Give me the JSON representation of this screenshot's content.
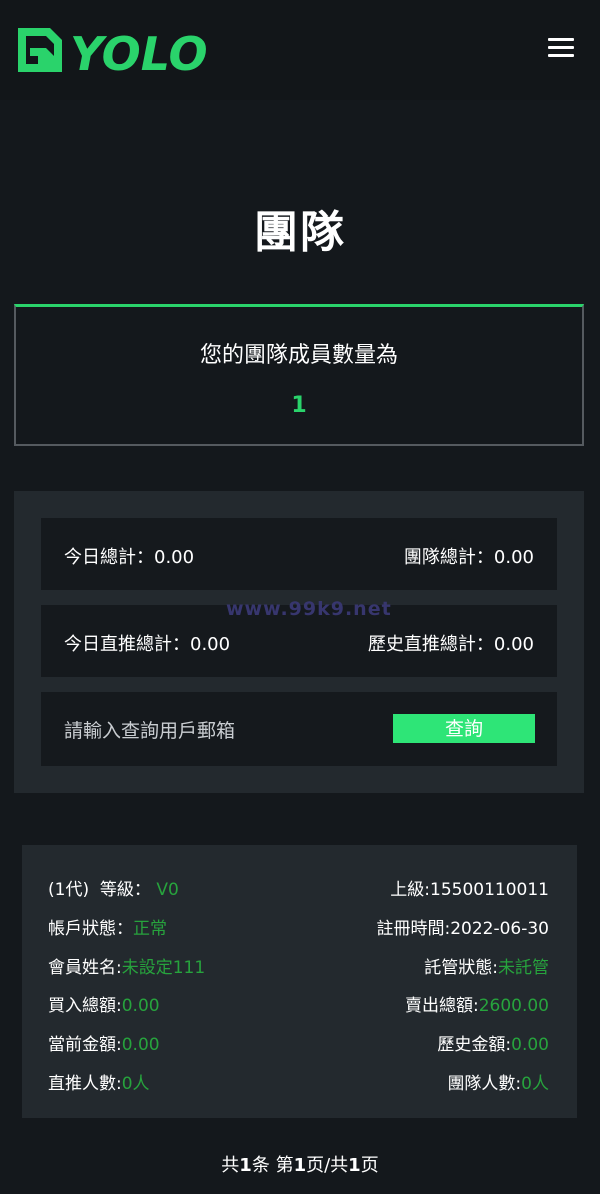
{
  "header": {
    "logo_text": "YOLO",
    "colors": {
      "brand": "#2ad36b",
      "header_bg": "#121619"
    }
  },
  "page": {
    "title": "團隊"
  },
  "team": {
    "label": "您的團隊成員數量為",
    "count": "1"
  },
  "stats": {
    "today_total_label": "今日總計：",
    "today_total_value": "0.00",
    "team_total_label": "團隊總計：",
    "team_total_value": "0.00",
    "today_direct_label": "今日直推總計：",
    "today_direct_value": "0.00",
    "history_direct_label": "歷史直推總計：",
    "history_direct_value": "0.00"
  },
  "search": {
    "placeholder": "請輸入查詢用戶郵箱",
    "button_label": "查詢"
  },
  "watermark": "www.99k9.net",
  "member": {
    "generation": "(1代)",
    "level_label": "等級：",
    "level_value": "V0",
    "superior_label": "上級:",
    "superior_value": "15500110011",
    "account_status_label": "帳戶狀態：",
    "account_status_value": "正常",
    "register_time_label": "註冊時間:",
    "register_time_value": "2022-06-30",
    "name_label": "會員姓名:",
    "name_value": "未設定111",
    "custody_label": "託管狀態:",
    "custody_value": "未託管",
    "buy_total_label": "買入總額:",
    "buy_total_value": "0.00",
    "sell_total_label": "賣出總額:",
    "sell_total_value": "2600.00",
    "current_amount_label": "當前金額:",
    "current_amount_value": "0.00",
    "history_amount_label": "歷史金額:",
    "history_amount_value": "0.00",
    "direct_count_label": "直推人數:",
    "direct_count_value": "0人",
    "team_count_label": "團隊人數:",
    "team_count_value": "0人"
  },
  "pagination": {
    "total_prefix": "共",
    "total": "1",
    "total_suffix": "条",
    "page_prefix": "第",
    "page": "1",
    "page_mid": "页/共",
    "pages": "1",
    "page_suffix": "页"
  }
}
